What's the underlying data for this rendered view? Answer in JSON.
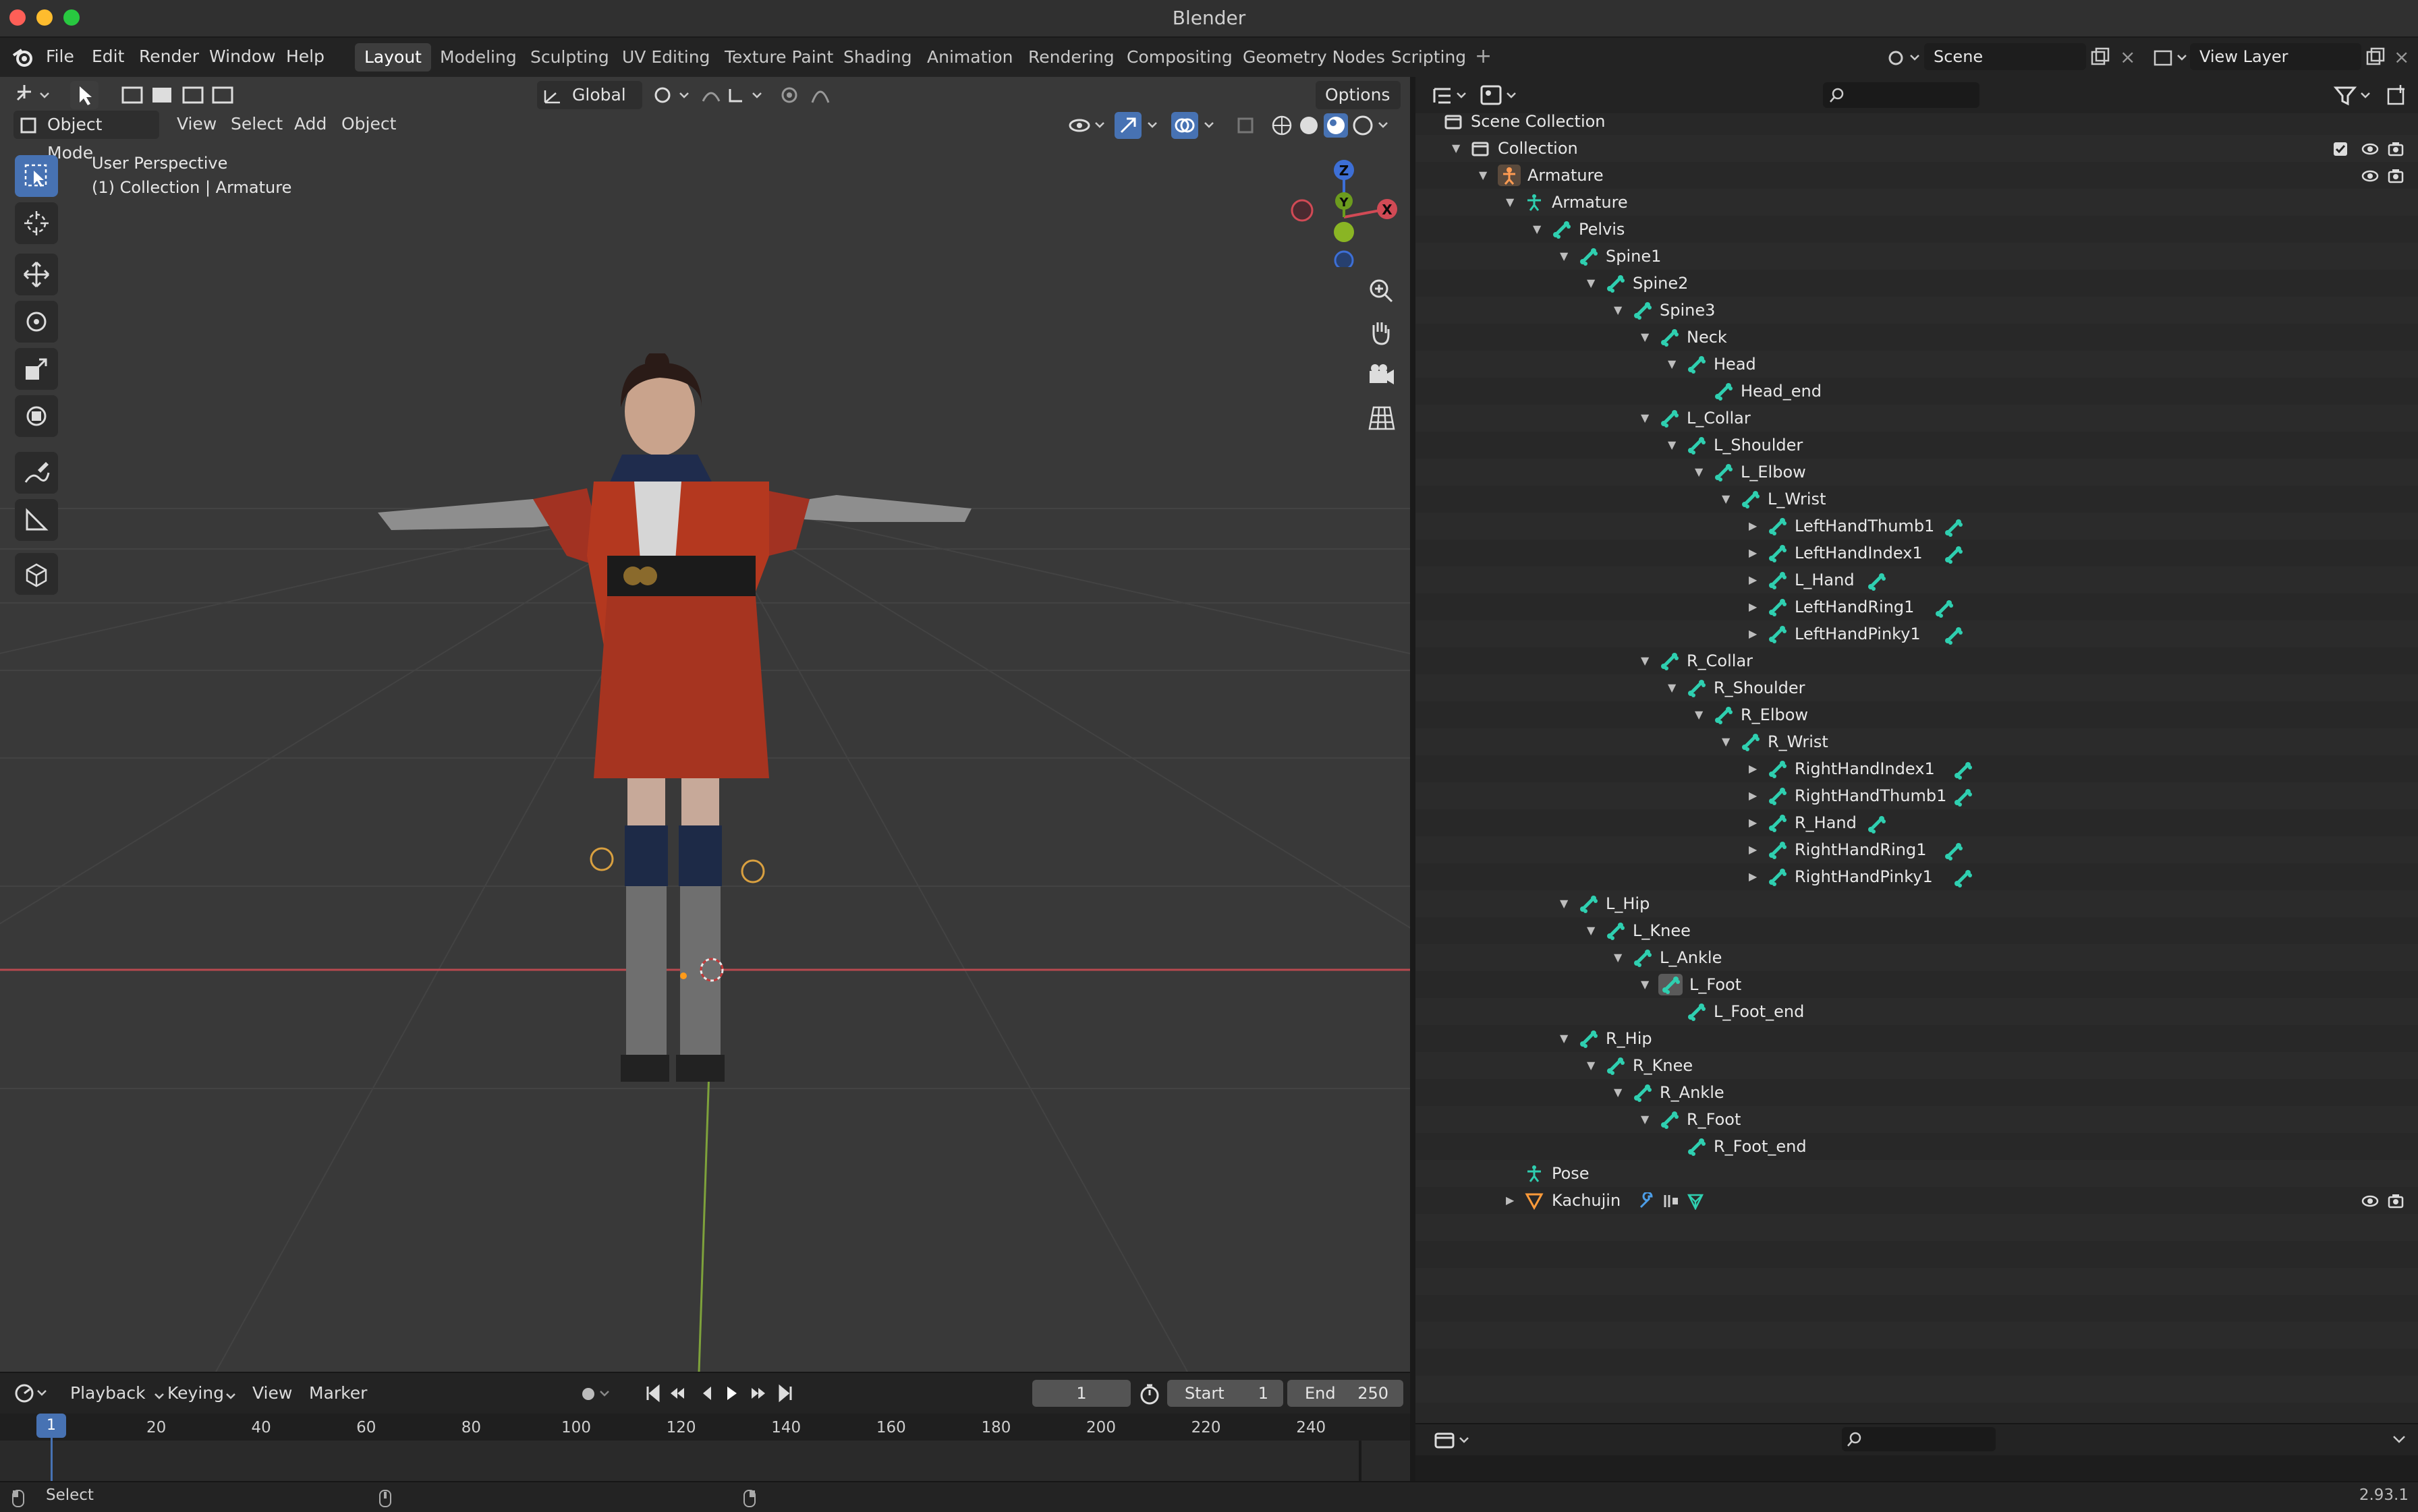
{
  "window": {
    "title": "Blender"
  },
  "menus": [
    "File",
    "Edit",
    "Render",
    "Window",
    "Help"
  ],
  "workspaces": [
    "Layout",
    "Modeling",
    "Sculpting",
    "UV Editing",
    "Texture Paint",
    "Shading",
    "Animation",
    "Rendering",
    "Compositing",
    "Geometry Nodes",
    "Scripting"
  ],
  "active_workspace": "Layout",
  "scene": {
    "name": "Scene",
    "view_layer": "View Layer"
  },
  "viewport": {
    "orientation": "Global",
    "options_label": "Options",
    "mode": "Object Mode",
    "header_menus": [
      "View",
      "Select",
      "Add",
      "Object"
    ],
    "perspective": "User Perspective",
    "collection_info": "(1) Collection | Armature",
    "gizmo": {
      "z": "Z",
      "y": "Y",
      "x": "X"
    }
  },
  "timeline": {
    "menus": [
      "Playback",
      "Keying",
      "View",
      "Marker"
    ],
    "current_frame": "1",
    "start_label": "Start",
    "start_value": "1",
    "end_label": "End",
    "end_value": "250",
    "ruler": [
      "20",
      "40",
      "60",
      "80",
      "100",
      "120",
      "140",
      "160",
      "180",
      "200",
      "220",
      "240"
    ],
    "playhead": "1"
  },
  "status": {
    "left": "Select",
    "version": "2.93.1"
  },
  "outliner": {
    "items": [
      {
        "label": "Scene Collection",
        "depth": 0,
        "icon": "collection-icon"
      },
      {
        "label": "Collection",
        "depth": 1,
        "icon": "collection-icon",
        "expand": "down"
      },
      {
        "label": "Armature",
        "depth": 2,
        "icon": "armature-object-icon",
        "expand": "down"
      },
      {
        "label": "Armature",
        "depth": 3,
        "icon": "armature-data-icon",
        "expand": "down"
      },
      {
        "label": "Pelvis",
        "depth": 4,
        "icon": "bone-icon",
        "expand": "down"
      },
      {
        "label": "Spine1",
        "depth": 5,
        "icon": "bone-icon",
        "expand": "down"
      },
      {
        "label": "Spine2",
        "depth": 6,
        "icon": "bone-icon",
        "expand": "down"
      },
      {
        "label": "Spine3",
        "depth": 7,
        "icon": "bone-icon",
        "expand": "down"
      },
      {
        "label": "Neck",
        "depth": 8,
        "icon": "bone-icon",
        "expand": "down"
      },
      {
        "label": "Head",
        "depth": 9,
        "icon": "bone-icon",
        "expand": "down"
      },
      {
        "label": "Head_end",
        "depth": 10,
        "icon": "bone-icon"
      },
      {
        "label": "L_Collar",
        "depth": 8,
        "icon": "bone-icon",
        "expand": "down"
      },
      {
        "label": "L_Shoulder",
        "depth": 9,
        "icon": "bone-icon",
        "expand": "down"
      },
      {
        "label": "L_Elbow",
        "depth": 10,
        "icon": "bone-icon",
        "expand": "down"
      },
      {
        "label": "L_Wrist",
        "depth": 11,
        "icon": "bone-icon",
        "expand": "down"
      },
      {
        "label": "LeftHandThumb1",
        "depth": 12,
        "icon": "bone-icon",
        "expand": "right",
        "extra": true
      },
      {
        "label": "LeftHandIndex1",
        "depth": 12,
        "icon": "bone-icon",
        "expand": "right",
        "extra": true
      },
      {
        "label": "L_Hand",
        "depth": 12,
        "icon": "bone-icon",
        "expand": "right",
        "extra": true
      },
      {
        "label": "LeftHandRing1",
        "depth": 12,
        "icon": "bone-icon",
        "expand": "right",
        "extra": true
      },
      {
        "label": "LeftHandPinky1",
        "depth": 12,
        "icon": "bone-icon",
        "expand": "right",
        "extra": true
      },
      {
        "label": "R_Collar",
        "depth": 8,
        "icon": "bone-icon",
        "expand": "down"
      },
      {
        "label": "R_Shoulder",
        "depth": 9,
        "icon": "bone-icon",
        "expand": "down"
      },
      {
        "label": "R_Elbow",
        "depth": 10,
        "icon": "bone-icon",
        "expand": "down"
      },
      {
        "label": "R_Wrist",
        "depth": 11,
        "icon": "bone-icon",
        "expand": "down"
      },
      {
        "label": "RightHandIndex1",
        "depth": 12,
        "icon": "bone-icon",
        "expand": "right",
        "extra": true
      },
      {
        "label": "RightHandThumb1",
        "depth": 12,
        "icon": "bone-icon",
        "expand": "right",
        "extra": true
      },
      {
        "label": "R_Hand",
        "depth": 12,
        "icon": "bone-icon",
        "expand": "right",
        "extra": true
      },
      {
        "label": "RightHandRing1",
        "depth": 12,
        "icon": "bone-icon",
        "expand": "right",
        "extra": true
      },
      {
        "label": "RightHandPinky1",
        "depth": 12,
        "icon": "bone-icon",
        "expand": "right",
        "extra": true
      },
      {
        "label": "L_Hip",
        "depth": 5,
        "icon": "bone-icon",
        "expand": "down"
      },
      {
        "label": "L_Knee",
        "depth": 6,
        "icon": "bone-icon",
        "expand": "down"
      },
      {
        "label": "L_Ankle",
        "depth": 7,
        "icon": "bone-icon",
        "expand": "down"
      },
      {
        "label": "L_Foot",
        "depth": 8,
        "icon": "bone-selected-icon",
        "expand": "down"
      },
      {
        "label": "L_Foot_end",
        "depth": 9,
        "icon": "bone-icon"
      },
      {
        "label": "R_Hip",
        "depth": 5,
        "icon": "bone-icon",
        "expand": "down"
      },
      {
        "label": "R_Knee",
        "depth": 6,
        "icon": "bone-icon",
        "expand": "down"
      },
      {
        "label": "R_Ankle",
        "depth": 7,
        "icon": "bone-icon",
        "expand": "down"
      },
      {
        "label": "R_Foot",
        "depth": 8,
        "icon": "bone-icon",
        "expand": "down"
      },
      {
        "label": "R_Foot_end",
        "depth": 9,
        "icon": "bone-icon"
      },
      {
        "label": "Pose",
        "depth": 3,
        "icon": "pose-icon"
      },
      {
        "label": "Kachujin",
        "depth": 3,
        "icon": "mesh-object-icon",
        "expand": "right"
      }
    ]
  }
}
